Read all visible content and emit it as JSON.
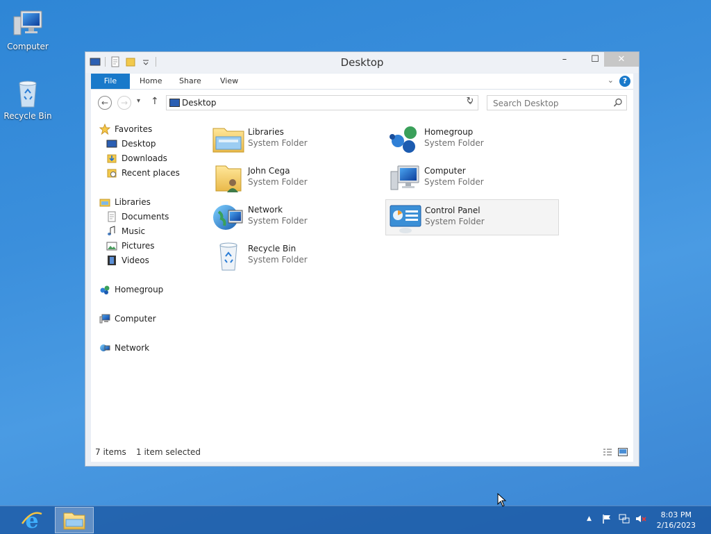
{
  "desktop": {
    "icons": [
      {
        "label": "Computer",
        "icon": "computer-icon"
      },
      {
        "label": "Recycle Bin",
        "icon": "recycle-bin-icon"
      }
    ]
  },
  "window": {
    "title": "Desktop",
    "controls": {
      "minimize": "–",
      "maximize": "☐",
      "close": "✕"
    },
    "ribbon_tabs": {
      "file": "File",
      "home": "Home",
      "share": "Share",
      "view": "View"
    },
    "help_label": "?",
    "address": {
      "path": "Desktop",
      "icon": "desktop-icon"
    },
    "search": {
      "placeholder": "Search Desktop"
    },
    "nav_pane": {
      "favorites": {
        "label": "Favorites",
        "items": [
          "Desktop",
          "Downloads",
          "Recent places"
        ]
      },
      "libraries": {
        "label": "Libraries",
        "items": [
          "Documents",
          "Music",
          "Pictures",
          "Videos"
        ]
      },
      "homegroup": "Homegroup",
      "computer": "Computer",
      "network": "Network"
    },
    "items": [
      {
        "name": "Libraries",
        "type": "System Folder",
        "icon": "libraries-icon"
      },
      {
        "name": "Homegroup",
        "type": "System Folder",
        "icon": "homegroup-icon"
      },
      {
        "name": "John Cega",
        "type": "System Folder",
        "icon": "user-folder-icon"
      },
      {
        "name": "Computer",
        "type": "System Folder",
        "icon": "computer-icon"
      },
      {
        "name": "Network",
        "type": "System Folder",
        "icon": "network-icon"
      },
      {
        "name": "Control Panel",
        "type": "System Folder",
        "icon": "control-panel-icon",
        "selected": true
      },
      {
        "name": "Recycle Bin",
        "type": "System Folder",
        "icon": "recycle-bin-icon"
      }
    ],
    "status": {
      "count": "7 items",
      "selection": "1 item selected"
    }
  },
  "taskbar": {
    "pinned": [
      {
        "name": "Internet Explorer",
        "icon": "internet-explorer-icon"
      },
      {
        "name": "File Explorer",
        "icon": "file-explorer-icon",
        "active": true
      }
    ],
    "tray": {
      "show_hidden": "▲",
      "icons": [
        "flag-icon",
        "network-icon",
        "volume-muted-icon"
      ]
    },
    "clock": {
      "time": "8:03 PM",
      "date": "2/16/2023"
    }
  },
  "colors": {
    "accent": "#1979ca",
    "desktop_bg": "#3b8fdc",
    "selection_bg": "#f4f4f4"
  }
}
